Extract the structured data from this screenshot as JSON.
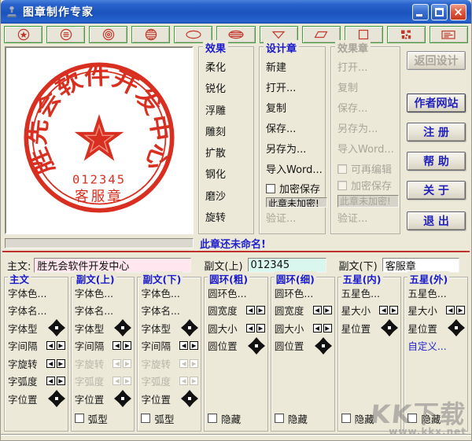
{
  "window": {
    "title": "图章制作专家"
  },
  "toolbar": {
    "buttons": [
      {
        "name": "round-star-seal",
        "icon": "circle-star-icon"
      },
      {
        "name": "round-text-seal",
        "icon": "circle-lines-icon"
      },
      {
        "name": "round-rings-seal",
        "icon": "circle-rings-icon"
      },
      {
        "name": "round-banded-seal",
        "icon": "circle-banded-icon"
      },
      {
        "name": "oval-seal",
        "icon": "ellipse-icon"
      },
      {
        "name": "oval-banded-seal",
        "icon": "ellipse-banded-icon"
      },
      {
        "name": "triangle-seal",
        "icon": "triangle-icon"
      },
      {
        "name": "parallelogram-seal",
        "icon": "parallelogram-icon"
      },
      {
        "name": "square-seal",
        "icon": "square-icon"
      },
      {
        "name": "pattern-seal",
        "icon": "pattern-block-icon"
      },
      {
        "name": "badge-seal",
        "icon": "card-lines-icon"
      }
    ]
  },
  "preview": {
    "stamp": {
      "main_text": "胜先会软件开发中心",
      "serial": "012345",
      "bottom_text": "客服章",
      "ink_color": "#d92f20"
    },
    "name_status": "此章还未命名!"
  },
  "effects_panel": {
    "title": "效果",
    "items": [
      "柔化",
      "锐化",
      "浮雕",
      "雕刻",
      "扩散",
      "钢化",
      "磨沙",
      "旋转"
    ]
  },
  "design_panel": {
    "title": "设计章",
    "commands": [
      "新建",
      "打开...",
      "复制",
      "保存...",
      "另存为...",
      "导入Word..."
    ],
    "encrypt_label": "加密保存",
    "encrypt_status": "此章未加密!",
    "verify_label": "验证..."
  },
  "effect_panel": {
    "title": "效果章",
    "commands": [
      "打开...",
      "复制",
      "保存...",
      "另存为...",
      "导入Word..."
    ],
    "reedit_label": "可再编辑",
    "encrypt_label": "加密保存",
    "encrypt_status": "此章未加密!",
    "verify_label": "验证..."
  },
  "action_buttons": [
    {
      "name": "return-to-design-button",
      "label": "返回设计",
      "disabled": true
    },
    {
      "name": "author-website-button",
      "label": "作者网站",
      "disabled": false
    },
    {
      "name": "register-button",
      "label": "注 册",
      "disabled": false
    },
    {
      "name": "help-button",
      "label": "帮 助",
      "disabled": false
    },
    {
      "name": "about-button",
      "label": "关 于",
      "disabled": false
    },
    {
      "name": "exit-button",
      "label": "退 出",
      "disabled": false
    }
  ],
  "text_inputs": {
    "main_label": "主文:",
    "main_value": "胜先会软件开发中心",
    "sub_upper_label": "副文(上)",
    "sub_upper_value": "012345",
    "sub_lower_label": "副文(下)",
    "sub_lower_value": "客服章"
  },
  "property_columns": [
    {
      "name": "main-text",
      "title": "主文",
      "rows": [
        {
          "label": "字体色...",
          "control": "none"
        },
        {
          "label": "字体名...",
          "control": "none"
        },
        {
          "label": "字体型",
          "control": "pad"
        },
        {
          "label": "字间隔",
          "control": "spin"
        },
        {
          "label": "字旋转",
          "control": "spin"
        },
        {
          "label": "字弧度",
          "control": "spin"
        },
        {
          "label": "字位置",
          "control": "pad"
        }
      ]
    },
    {
      "name": "sub-upper",
      "title": "副文(上)",
      "rows": [
        {
          "label": "字体色...",
          "control": "none"
        },
        {
          "label": "字体名...",
          "control": "none"
        },
        {
          "label": "字体型",
          "control": "pad"
        },
        {
          "label": "字间隔",
          "control": "spin"
        },
        {
          "label": "字旋转",
          "control": "spin",
          "disabled": true
        },
        {
          "label": "字弧度",
          "control": "spin",
          "disabled": true
        },
        {
          "label": "字位置",
          "control": "pad"
        }
      ],
      "checkbox": "弧型"
    },
    {
      "name": "sub-lower",
      "title": "副文(下)",
      "rows": [
        {
          "label": "字体色...",
          "control": "none"
        },
        {
          "label": "字体名...",
          "control": "none"
        },
        {
          "label": "字体型",
          "control": "pad"
        },
        {
          "label": "字间隔",
          "control": "spin"
        },
        {
          "label": "字旋转",
          "control": "spin",
          "disabled": true
        },
        {
          "label": "字弧度",
          "control": "spin",
          "disabled": true
        },
        {
          "label": "字位置",
          "control": "pad"
        }
      ],
      "checkbox": "弧型"
    },
    {
      "name": "ring-thick",
      "title": "圆环(粗)",
      "rows": [
        {
          "label": "圆环色...",
          "control": "none"
        },
        {
          "label": "圆宽度",
          "control": "spin"
        },
        {
          "label": "圆大小",
          "control": "spin"
        },
        {
          "label": "圆位置",
          "control": "pad"
        }
      ],
      "checkbox": "隐藏"
    },
    {
      "name": "ring-thin",
      "title": "圆环(细)",
      "rows": [
        {
          "label": "圆环色...",
          "control": "none"
        },
        {
          "label": "圆宽度",
          "control": "spin"
        },
        {
          "label": "圆大小",
          "control": "spin"
        },
        {
          "label": "圆位置",
          "control": "pad"
        }
      ],
      "checkbox": "隐藏"
    },
    {
      "name": "star-inner",
      "title": "五星(内)",
      "rows": [
        {
          "label": "五星色...",
          "control": "none"
        },
        {
          "label": "星大小",
          "control": "spin"
        },
        {
          "label": "星位置",
          "control": "pad"
        }
      ],
      "checkbox": "隐藏"
    },
    {
      "name": "star-outer",
      "title": "五星(外)",
      "rows": [
        {
          "label": "五星色...",
          "control": "none"
        },
        {
          "label": "星大小",
          "control": "spin"
        },
        {
          "label": "星位置",
          "control": "pad"
        },
        {
          "label": "自定义...",
          "control": "none",
          "accent": true
        }
      ],
      "checkbox": "隐藏"
    }
  ],
  "watermark": {
    "logo": "KK下载",
    "url": "www.kkx.net"
  },
  "colors": {
    "accent_blue": "#1a1acc",
    "stamp_red": "#d92f20",
    "titlebar_blue": "#1f5ac6",
    "pink_field": "#ffe6ef",
    "cyan_field": "#d9f7ee"
  }
}
